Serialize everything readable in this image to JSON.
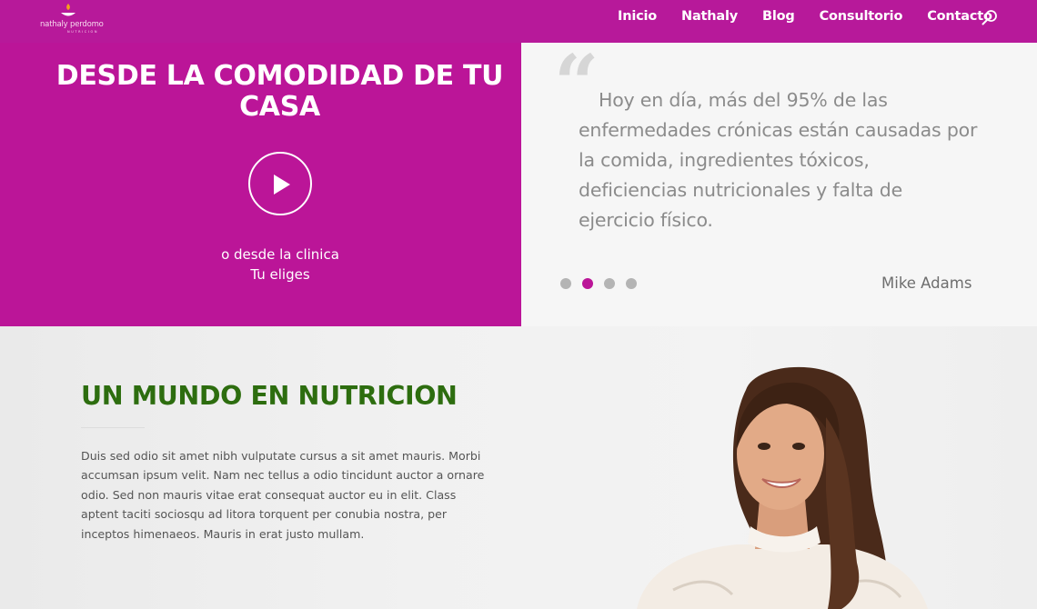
{
  "logo": {
    "name": "nathaly perdomo",
    "tagline": "NUTRICION"
  },
  "nav": {
    "items": [
      "Inicio",
      "Nathaly",
      "Blog",
      "Consultorio",
      "Contacto"
    ]
  },
  "hero": {
    "title": "DESDE LA COMODIDAD DE TU CASA",
    "subtitle_line1": "o desde la clinica",
    "subtitle_line2": "Tu eliges"
  },
  "testimonial": {
    "quote": "Hoy en día, más del 95% de las enfermedades crónicas están causadas por la comida, ingredientes tóxicos, deficiencias nutricionales y falta de ejercicio físico.",
    "author": "Mike Adams",
    "slide_count": 4,
    "active_slide": 2
  },
  "about": {
    "title": "UN MUNDO EN NUTRICION",
    "text": "Duis sed odio sit amet nibh vulputate cursus a sit amet mauris. Morbi accumsan ipsum velit. Nam nec tellus a odio tincidunt auctor a ornare odio. Sed non mauris vitae erat consequat auctor eu in elit. Class aptent taciti sociosqu ad litora torquent per conubia nostra, per inceptos himenaeos. Mauris in erat justo mullam."
  },
  "colors": {
    "brand": "#bb1598",
    "heading_green": "#2d6d0f",
    "quote_gray": "#8b8b8b"
  },
  "icons": {
    "play": "play-icon",
    "search": "search-icon",
    "quote": "quote-icon"
  }
}
